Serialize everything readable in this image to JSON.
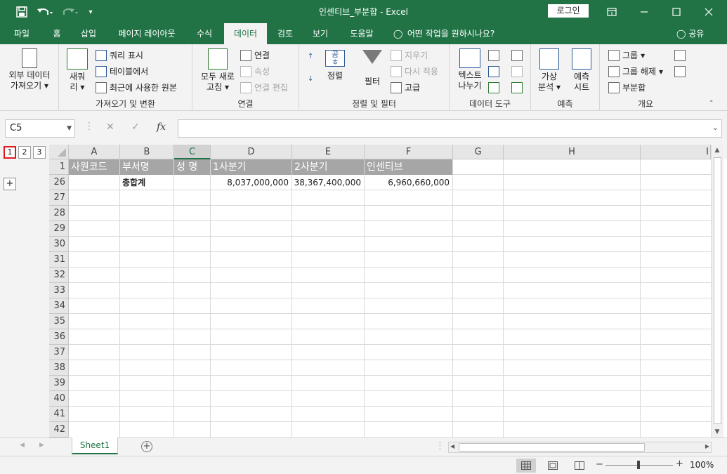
{
  "app": {
    "title": "인센티브_부분합  -  Excel",
    "login_label": "로그인"
  },
  "tabs": [
    {
      "label": "파일"
    },
    {
      "label": "홈"
    },
    {
      "label": "삽입"
    },
    {
      "label": "페이지 레이아웃"
    },
    {
      "label": "수식"
    },
    {
      "label": "데이터"
    },
    {
      "label": "검토"
    },
    {
      "label": "보기"
    },
    {
      "label": "도움말"
    }
  ],
  "active_tab": "데이터",
  "tell_me": "어떤 작업을 원하시나요?",
  "share_label": "공유",
  "ribbon": {
    "external_data": {
      "line1": "외부 데이터",
      "line2": "가져오기"
    },
    "get_transform": {
      "new_query": {
        "line1": "새쿼",
        "line2": "리"
      },
      "show_queries": "쿼리 표시",
      "from_table": "테이블에서",
      "recent_sources": "최근에 사용한 원본",
      "label": "가져오기 및 변환"
    },
    "connections": {
      "refresh_all": {
        "line1": "모두 새로",
        "line2": "고침"
      },
      "connections": "연결",
      "properties": "속성",
      "edit_links": "연결 편집",
      "label": "연결"
    },
    "sort_filter": {
      "sort": "정렬",
      "sort_box_top": "공",
      "sort_box_bottom": "ㅎ",
      "filter": "필터",
      "clear": "지우기",
      "reapply": "다시 적용",
      "advanced": "고급",
      "label": "정렬 및 필터"
    },
    "data_tools": {
      "text_to_columns": {
        "line1": "텍스트",
        "line2": "나누기"
      },
      "label": "데이터 도구"
    },
    "forecast": {
      "what_if": {
        "line1": "가상",
        "line2": "분석"
      },
      "forecast_sheet": {
        "line1": "예측",
        "line2": "시트"
      },
      "label": "예측"
    },
    "outline": {
      "group": "그룹",
      "ungroup": "그룹 해제",
      "subtotal": "부분합",
      "label": "개요"
    }
  },
  "formula_bar": {
    "name_box": "C5",
    "fx_label": "fx",
    "formula": ""
  },
  "outline_levels": [
    "1",
    "2",
    "3"
  ],
  "outline_expand": "+",
  "columns": [
    "A",
    "B",
    "C",
    "D",
    "E",
    "F",
    "G",
    "H",
    "I"
  ],
  "selected_column": "C",
  "rows": [
    "1",
    "26",
    "27",
    "28",
    "29",
    "30",
    "31",
    "32",
    "33",
    "34",
    "35",
    "36",
    "37",
    "38",
    "39",
    "40",
    "41",
    "42"
  ],
  "header_row": {
    "A": "사원코드",
    "B": "부서명",
    "C": "성  명",
    "D": "1사분기",
    "E": "2사분기",
    "F": "인센티브"
  },
  "total_row": {
    "B": "총합계",
    "D": "8,037,000,000",
    "E": "38,367,400,000",
    "F": "6,960,660,000"
  },
  "sheets": [
    {
      "name": "Sheet1"
    }
  ],
  "status": {
    "zoom": "100%"
  },
  "colors": {
    "accent": "#217346",
    "header_fill": "#a6a6a6",
    "highlight_box": "#e0191f"
  },
  "icons": [
    "save-icon",
    "undo-icon",
    "redo-icon",
    "customize-icon",
    "restore-icon",
    "minimize-icon",
    "maximize-icon",
    "close-icon",
    "lightbulb-icon",
    "person-icon",
    "plus-icon"
  ]
}
